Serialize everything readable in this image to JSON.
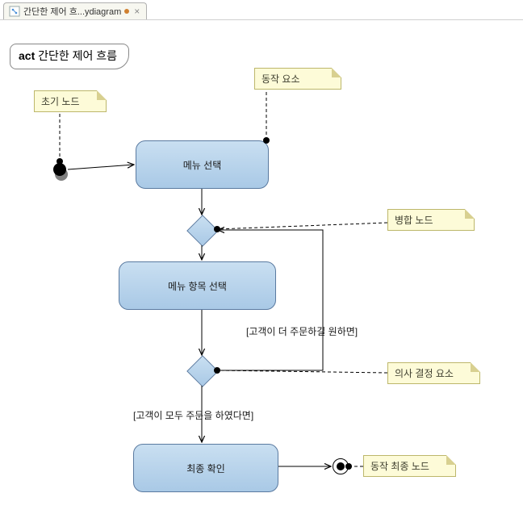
{
  "tab": {
    "label": "간단한 제어 흐...ydiagram",
    "dirty": "●"
  },
  "frame": {
    "keyword": "act",
    "title": "간단한 제어 흐름"
  },
  "notes": {
    "initial": "초기 노드",
    "action": "동작 요소",
    "merge": "병합 노드",
    "decision": "의사 결정 요소",
    "final": "동작 최종 노드"
  },
  "activities": {
    "menuSelect": "메뉴 선택",
    "menuItemSelect": "메뉴 항목 선택",
    "finalConfirm": "최종 확인"
  },
  "guards": {
    "moreOrders": "[고객이 더 주문하길 원하면]",
    "allOrdered": "[고객이 모두 주문을 하였다면]"
  },
  "chart_data": {
    "type": "activity-diagram",
    "title": "act 간단한 제어 흐름",
    "nodes": [
      {
        "id": "initial",
        "kind": "initial",
        "note": "초기 노드"
      },
      {
        "id": "a1",
        "kind": "action",
        "label": "메뉴 선택",
        "note": "동작 요소"
      },
      {
        "id": "merge",
        "kind": "merge",
        "note": "병합 노드"
      },
      {
        "id": "a2",
        "kind": "action",
        "label": "메뉴 항목 선택"
      },
      {
        "id": "decision",
        "kind": "decision",
        "note": "의사 결정 요소"
      },
      {
        "id": "a3",
        "kind": "action",
        "label": "최종 확인"
      },
      {
        "id": "final",
        "kind": "activity-final",
        "note": "동작 최종 노드"
      }
    ],
    "edges": [
      {
        "from": "initial",
        "to": "a1"
      },
      {
        "from": "a1",
        "to": "merge"
      },
      {
        "from": "merge",
        "to": "a2"
      },
      {
        "from": "a2",
        "to": "decision"
      },
      {
        "from": "decision",
        "to": "merge",
        "guard": "[고객이 더 주문하길 원하면]"
      },
      {
        "from": "decision",
        "to": "a3",
        "guard": "[고객이 모두 주문을 하였다면]"
      },
      {
        "from": "a3",
        "to": "final"
      }
    ]
  }
}
